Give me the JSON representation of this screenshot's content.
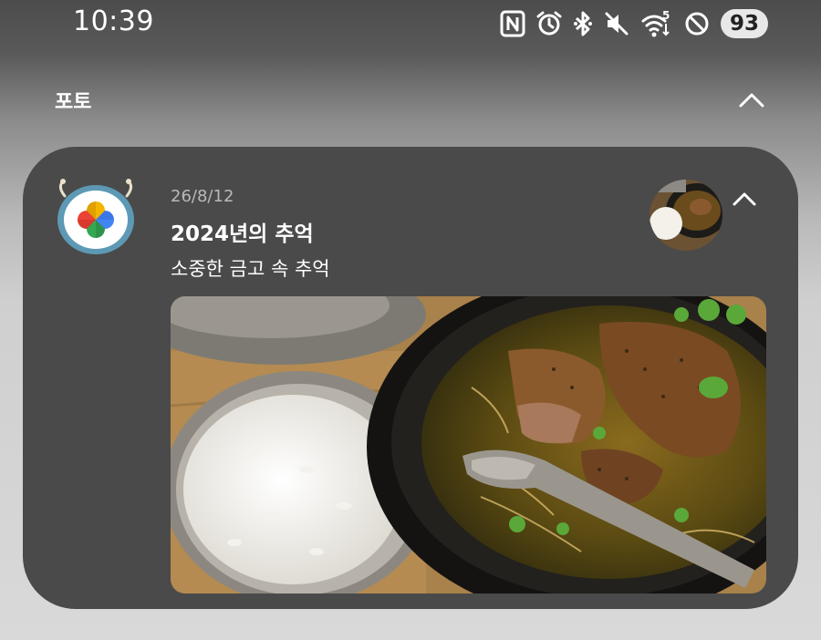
{
  "status_bar": {
    "time": "10:39",
    "battery": "93",
    "icons": [
      "nfc-icon",
      "alarm-icon",
      "bluetooth-icon",
      "vibrate-off-icon",
      "wifi-icon",
      "do-not-disturb-icon"
    ],
    "wifi_badge": "5"
  },
  "group": {
    "title": "포토"
  },
  "notification": {
    "app_icon": "google-photos-icon",
    "time": "26/8/12",
    "title": "2024년의 추억",
    "subtitle": "소중한 금고 속 추억",
    "image": "food-photo-rice-and-galbitang"
  },
  "colors": {
    "card_bg": "#4a4a4a",
    "text_primary": "#ffffff",
    "text_secondary": "#b9b9b9"
  }
}
